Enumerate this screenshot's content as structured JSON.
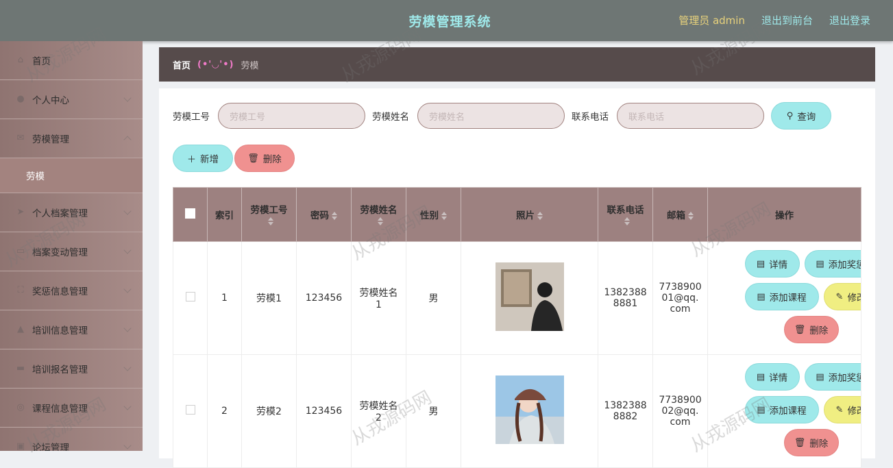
{
  "header": {
    "title": "劳模管理系统",
    "admin": "管理员 admin",
    "to_front": "退出到前台",
    "logout": "退出登录"
  },
  "sidebar": {
    "items": [
      {
        "label": "首页",
        "icon": "home-icon"
      },
      {
        "label": "个人中心",
        "icon": "user-icon"
      },
      {
        "label": "劳模管理",
        "icon": "mail-icon"
      },
      {
        "label": "个人档案管理",
        "icon": "send-icon"
      },
      {
        "label": "档案变动管理",
        "icon": "monitor-icon"
      },
      {
        "label": "奖惩信息管理",
        "icon": "fullscreen-icon"
      },
      {
        "label": "培训信息管理",
        "icon": "thumb-icon"
      },
      {
        "label": "培训报名管理",
        "icon": "film-icon"
      },
      {
        "label": "课程信息管理",
        "icon": "compass-icon"
      },
      {
        "label": "论坛管理",
        "icon": "chat-icon"
      }
    ],
    "sub_active": "劳模"
  },
  "breadcrumb": {
    "home": "首页",
    "separator": "(•'◡'•)",
    "current": "劳模"
  },
  "search": {
    "fields": [
      {
        "label": "劳模工号",
        "placeholder": "劳模工号"
      },
      {
        "label": "劳模姓名",
        "placeholder": "劳模姓名"
      },
      {
        "label": "联系电话",
        "placeholder": "联系电话"
      }
    ],
    "query_label": "查询"
  },
  "actions": {
    "add_label": "新增",
    "delete_label": "删除"
  },
  "table": {
    "columns": [
      "索引",
      "劳模工号",
      "密码",
      "劳模姓名",
      "性别",
      "照片",
      "联系电话",
      "邮箱",
      "操作"
    ],
    "rows": [
      {
        "index": "1",
        "id": "劳模1",
        "password": "123456",
        "name_l1": "劳模姓名",
        "name_l2": "1",
        "gender": "男",
        "phone_l1": "1382388",
        "phone_l2": "8881",
        "email_l1": "7738900",
        "email_l2": "01@qq.",
        "email_l3": "com"
      },
      {
        "index": "2",
        "id": "劳模2",
        "password": "123456",
        "name_l1": "劳模姓名",
        "name_l2": "2",
        "gender": "男",
        "phone_l1": "1382388",
        "phone_l2": "8882",
        "email_l1": "7738900",
        "email_l2": "02@qq.",
        "email_l3": "com"
      }
    ],
    "ops": {
      "detail": "详情",
      "add_award": "添加奖惩",
      "add_course": "添加课程",
      "edit": "修改",
      "delete": "删除"
    }
  },
  "watermark": "从戎源码网",
  "colors": {
    "header_bg": "#6e7674",
    "sidebar_bg": "#a1827f",
    "accent_cyan": "#9fe9ea",
    "accent_red": "#f09190",
    "accent_yellow": "#f0ee82",
    "table_header": "#9d8180"
  }
}
